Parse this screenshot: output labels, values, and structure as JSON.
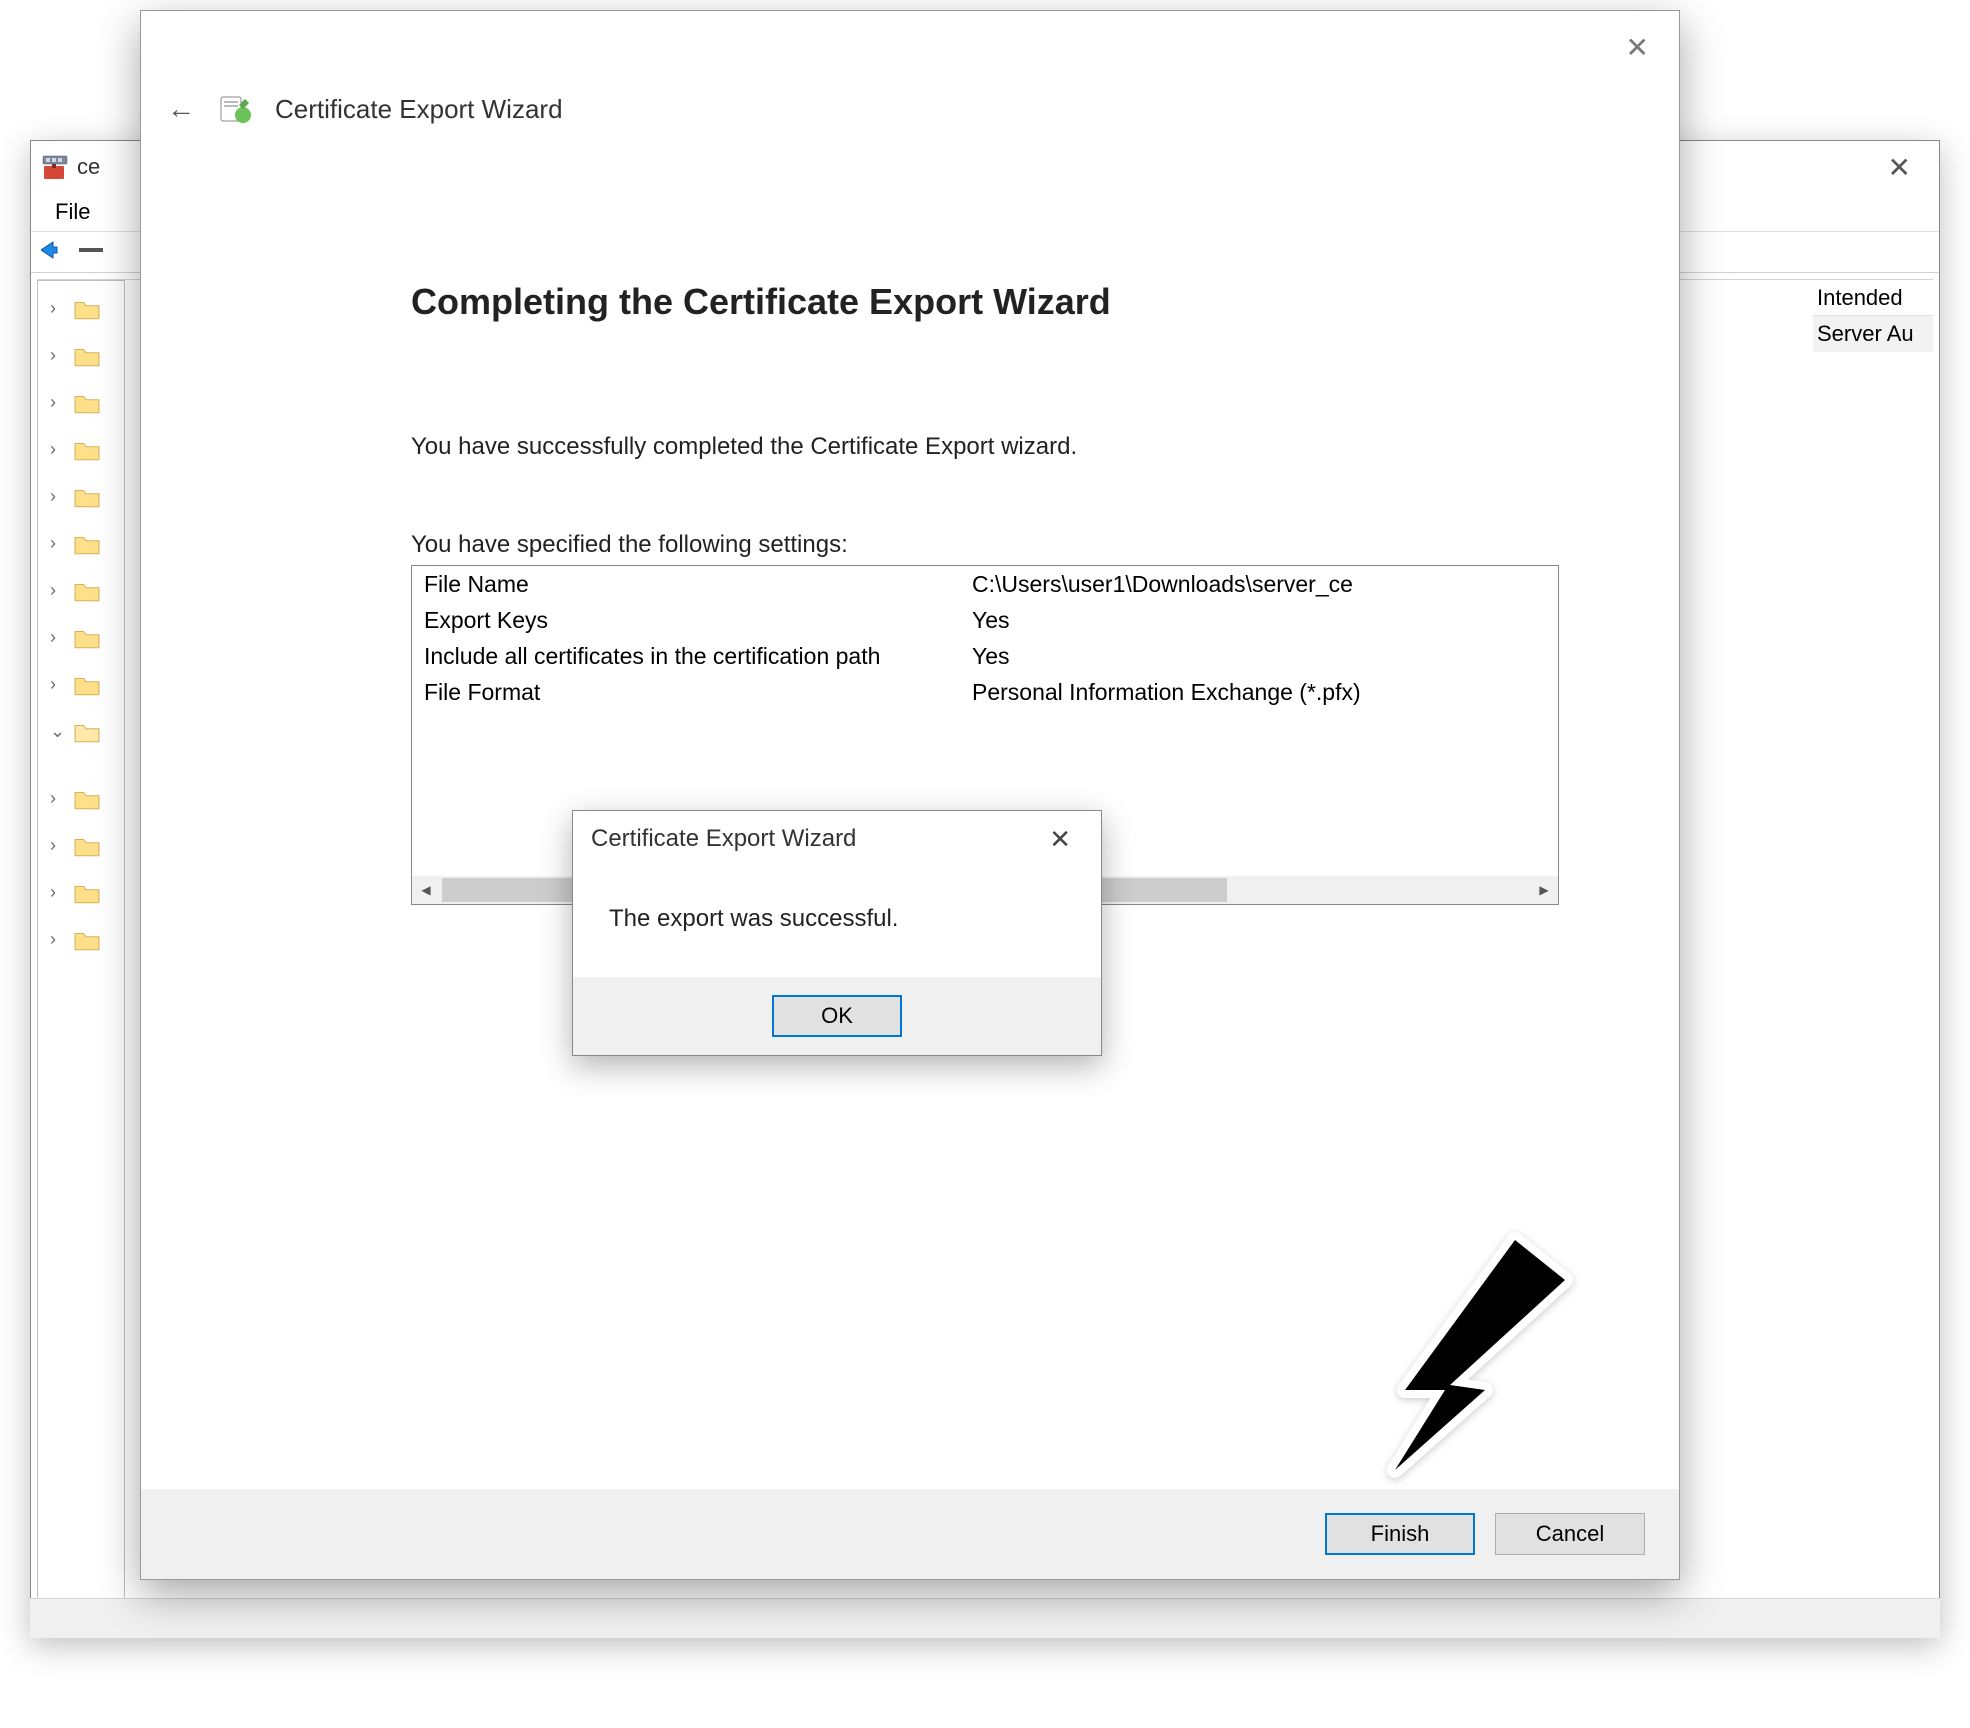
{
  "mmc": {
    "title_fragment": "ce",
    "menu": {
      "file": "File"
    },
    "right_pane": {
      "header_fragment": "Intended",
      "row_fragment": "Server Au"
    }
  },
  "wizard": {
    "title": "Certificate Export Wizard",
    "heading": "Completing the Certificate Export Wizard",
    "success_text": "You have successfully completed the Certificate Export wizard.",
    "settings_label": "You have specified the following settings:",
    "rows": [
      {
        "k": "File Name",
        "v": "C:\\Users\\user1\\Downloads\\server_ce"
      },
      {
        "k": "Export Keys",
        "v": "Yes"
      },
      {
        "k": "Include all certificates in the certification path",
        "v": "Yes"
      },
      {
        "k": "File Format",
        "v": "Personal Information Exchange (*.pfx)"
      }
    ],
    "buttons": {
      "finish": "Finish",
      "cancel": "Cancel"
    }
  },
  "msgbox": {
    "title": "Certificate Export Wizard",
    "body": "The export was successful.",
    "ok": "OK"
  }
}
